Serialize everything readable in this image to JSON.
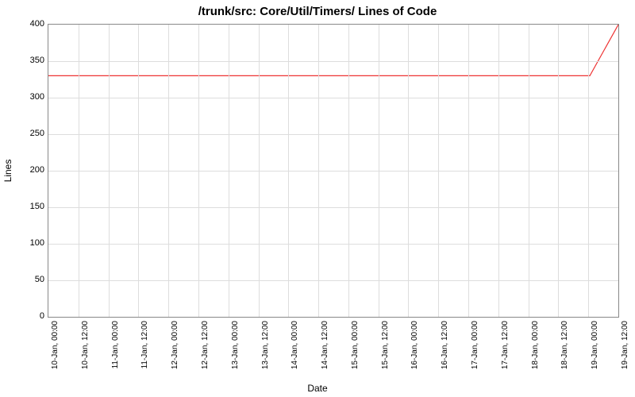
{
  "chart_data": {
    "type": "line",
    "title": "/trunk/src: Core/Util/Timers/ Lines of Code",
    "xlabel": "Date",
    "ylabel": "Lines",
    "ylim": [
      0,
      400
    ],
    "y_ticks": [
      0,
      50,
      100,
      150,
      200,
      250,
      300,
      350,
      400
    ],
    "x_ticks": [
      "10-Jan, 00:00",
      "10-Jan, 12:00",
      "11-Jan, 00:00",
      "11-Jan, 12:00",
      "12-Jan, 00:00",
      "12-Jan, 12:00",
      "13-Jan, 00:00",
      "13-Jan, 12:00",
      "14-Jan, 00:00",
      "14-Jan, 12:00",
      "15-Jan, 00:00",
      "15-Jan, 12:00",
      "16-Jan, 00:00",
      "16-Jan, 12:00",
      "17-Jan, 00:00",
      "17-Jan, 12:00",
      "18-Jan, 00:00",
      "18-Jan, 12:00",
      "19-Jan, 00:00",
      "19-Jan, 12:00"
    ],
    "series": [
      {
        "name": "Lines of Code",
        "color": "#ee3333",
        "x": [
          "10-Jan, 00:00",
          "10-Jan, 12:00",
          "11-Jan, 00:00",
          "11-Jan, 12:00",
          "12-Jan, 00:00",
          "12-Jan, 12:00",
          "13-Jan, 00:00",
          "13-Jan, 12:00",
          "14-Jan, 00:00",
          "14-Jan, 12:00",
          "15-Jan, 00:00",
          "15-Jan, 12:00",
          "16-Jan, 00:00",
          "16-Jan, 12:00",
          "17-Jan, 00:00",
          "17-Jan, 12:00",
          "18-Jan, 00:00",
          "18-Jan, 12:00",
          "19-Jan, 00:00",
          "19-Jan, 12:00",
          "19-Jan, 13:00"
        ],
        "values": [
          330,
          330,
          330,
          330,
          330,
          330,
          330,
          330,
          330,
          330,
          330,
          330,
          330,
          330,
          330,
          330,
          330,
          330,
          330,
          330,
          400
        ]
      }
    ]
  }
}
